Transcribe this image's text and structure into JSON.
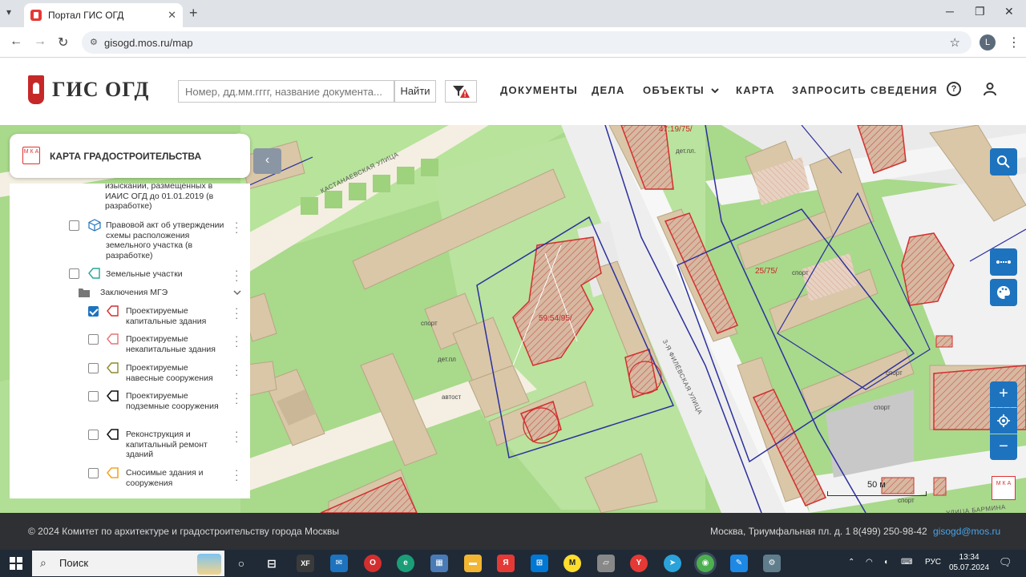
{
  "browser": {
    "tab_title": "Портал ГИС ОГД",
    "tab_close": "✕",
    "new_tab": "+",
    "url": "gisogd.mos.ru/map",
    "profile_initial": "L"
  },
  "header": {
    "logo_text": "ГИС ОГД",
    "search_placeholder": "Номер, дд.мм.гггг, название документа...",
    "search_button": "Найти",
    "nav": [
      {
        "label": "ДОКУМЕНТЫ"
      },
      {
        "label": "ДЕЛА"
      },
      {
        "label": "ОБЪЕКТЫ"
      },
      {
        "label": "КАРТА"
      },
      {
        "label": "ЗАПРОСИТЬ СВЕДЕНИЯ"
      }
    ],
    "help_symbol": "?"
  },
  "panel": {
    "title": "КАРТА ГРАДОСТРОИТЕЛЬСТВА",
    "logo_letters": "М К А",
    "items": [
      {
        "label": "изысканий, размещенных в ИАИС ОГД до 01.01.2019 (в разработке)",
        "checked": false,
        "icon": "none"
      },
      {
        "label": "Правовой акт об утверждении схемы расположения земельного участка (в разработке)",
        "checked": false,
        "icon": "cube-icon"
      },
      {
        "label": "Земельные участки",
        "checked": false,
        "icon": "pentagon-teal-icon"
      },
      {
        "label": "Заключения МГЭ",
        "checked": false,
        "icon": "folder-icon"
      },
      {
        "label": "Проектируемые капитальные здания",
        "checked": true,
        "icon": "pentagon-red-icon"
      },
      {
        "label": "Проектируемые некапитальные здания",
        "checked": false,
        "icon": "pentagon-pink-icon"
      },
      {
        "label": "Проектируемые навесные сооружения",
        "checked": false,
        "icon": "pentagon-olive-icon"
      },
      {
        "label": "Проектируемые подземные сооружения",
        "checked": false,
        "icon": "pentagon-black-icon"
      },
      {
        "label": "Реконструкция и капитальный ремонт зданий",
        "checked": false,
        "icon": "pentagon-black-icon"
      },
      {
        "label": "Сносимые здания и сооружения",
        "checked": false,
        "icon": "pentagon-orange-icon"
      }
    ],
    "collapse_symbol": "‹"
  },
  "map": {
    "street_labels": [
      "КАСТАНАЕВСКАЯ УЛИЦА",
      "3-Я ФИЛЁВСКАЯ УЛИЦА",
      "УЛИЦА БАРМИНА"
    ],
    "parcel_labels": [
      "47:19/75/",
      "59:54/95/",
      "25/75/"
    ],
    "place_labels": [
      "дет.пл.",
      "спорт",
      "дет.пл",
      "автост",
      "спорт",
      "спорт",
      "спорт",
      "спорт"
    ],
    "scale_label": "50 м",
    "logo_letters": "М К А",
    "zoom_in": "+",
    "zoom_out": "−"
  },
  "footer": {
    "copyright": "© 2024 Комитет по архитектуре и градостроительству города Москвы",
    "address": "Москва, Триумфальная пл. д. 1",
    "phone": "8(499) 250-98-42",
    "email": "gisogd@mos.ru"
  },
  "taskbar": {
    "search_placeholder": "Поиск",
    "language": "РУС",
    "time": "13:34",
    "date": "05.07.2024"
  },
  "colors": {
    "accent_blue": "#1e73be",
    "map_green": "#a9d98b",
    "building": "#d9c7a8",
    "parcel_red": "#d32f2f",
    "boundary_blue": "#2b2f9e",
    "footer_bg": "#2e3033"
  }
}
